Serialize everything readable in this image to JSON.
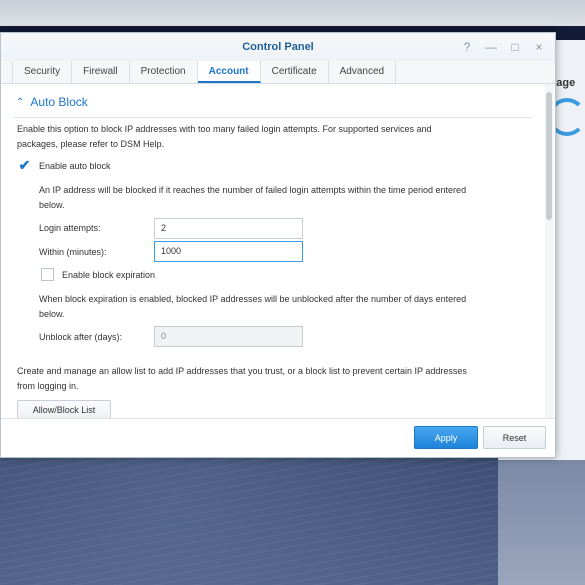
{
  "window": {
    "title": "Control Panel",
    "controls": [
      "?",
      "—",
      "□",
      "×"
    ]
  },
  "tabs": [
    {
      "label": "Security"
    },
    {
      "label": "Firewall"
    },
    {
      "label": "Protection"
    },
    {
      "label": "Account",
      "active": true
    },
    {
      "label": "Certificate"
    },
    {
      "label": "Advanced"
    }
  ],
  "section": {
    "title": "Auto Block",
    "description_line1": "Enable this option to block IP addresses with too many failed login attempts. For supported services and",
    "description_line2": "packages, please refer to DSM Help.",
    "enable_auto_block": {
      "label": "Enable auto block",
      "checked": true
    },
    "block_info_line1": "An IP address will be blocked if it reaches the number of failed login attempts within the time period entered",
    "block_info_line2": "below.",
    "login_attempts": {
      "label": "Login attempts:",
      "value": "2"
    },
    "within_minutes": {
      "label": "Within (minutes):",
      "value": "1000"
    },
    "enable_block_expiration": {
      "label": "Enable block expiration",
      "checked": false
    },
    "expiration_info_line1": "When block expiration is enabled, blocked IP addresses will be unblocked after the number of days entered",
    "expiration_info_line2": "below.",
    "unblock_after": {
      "label": "Unblock after (days):",
      "value": "0"
    },
    "list_info_line1": "Create and manage an allow list to add IP addresses that you trust, or a block list to prevent certain IP addresses",
    "list_info_line2": "from logging in.",
    "allow_block_button": "Allow/Block List"
  },
  "footer": {
    "apply": "Apply",
    "reset": "Reset"
  },
  "background_window": {
    "partial_text": "rage"
  },
  "colors": {
    "accent": "#1e75c9",
    "apply_button": "#2a8fe3"
  }
}
